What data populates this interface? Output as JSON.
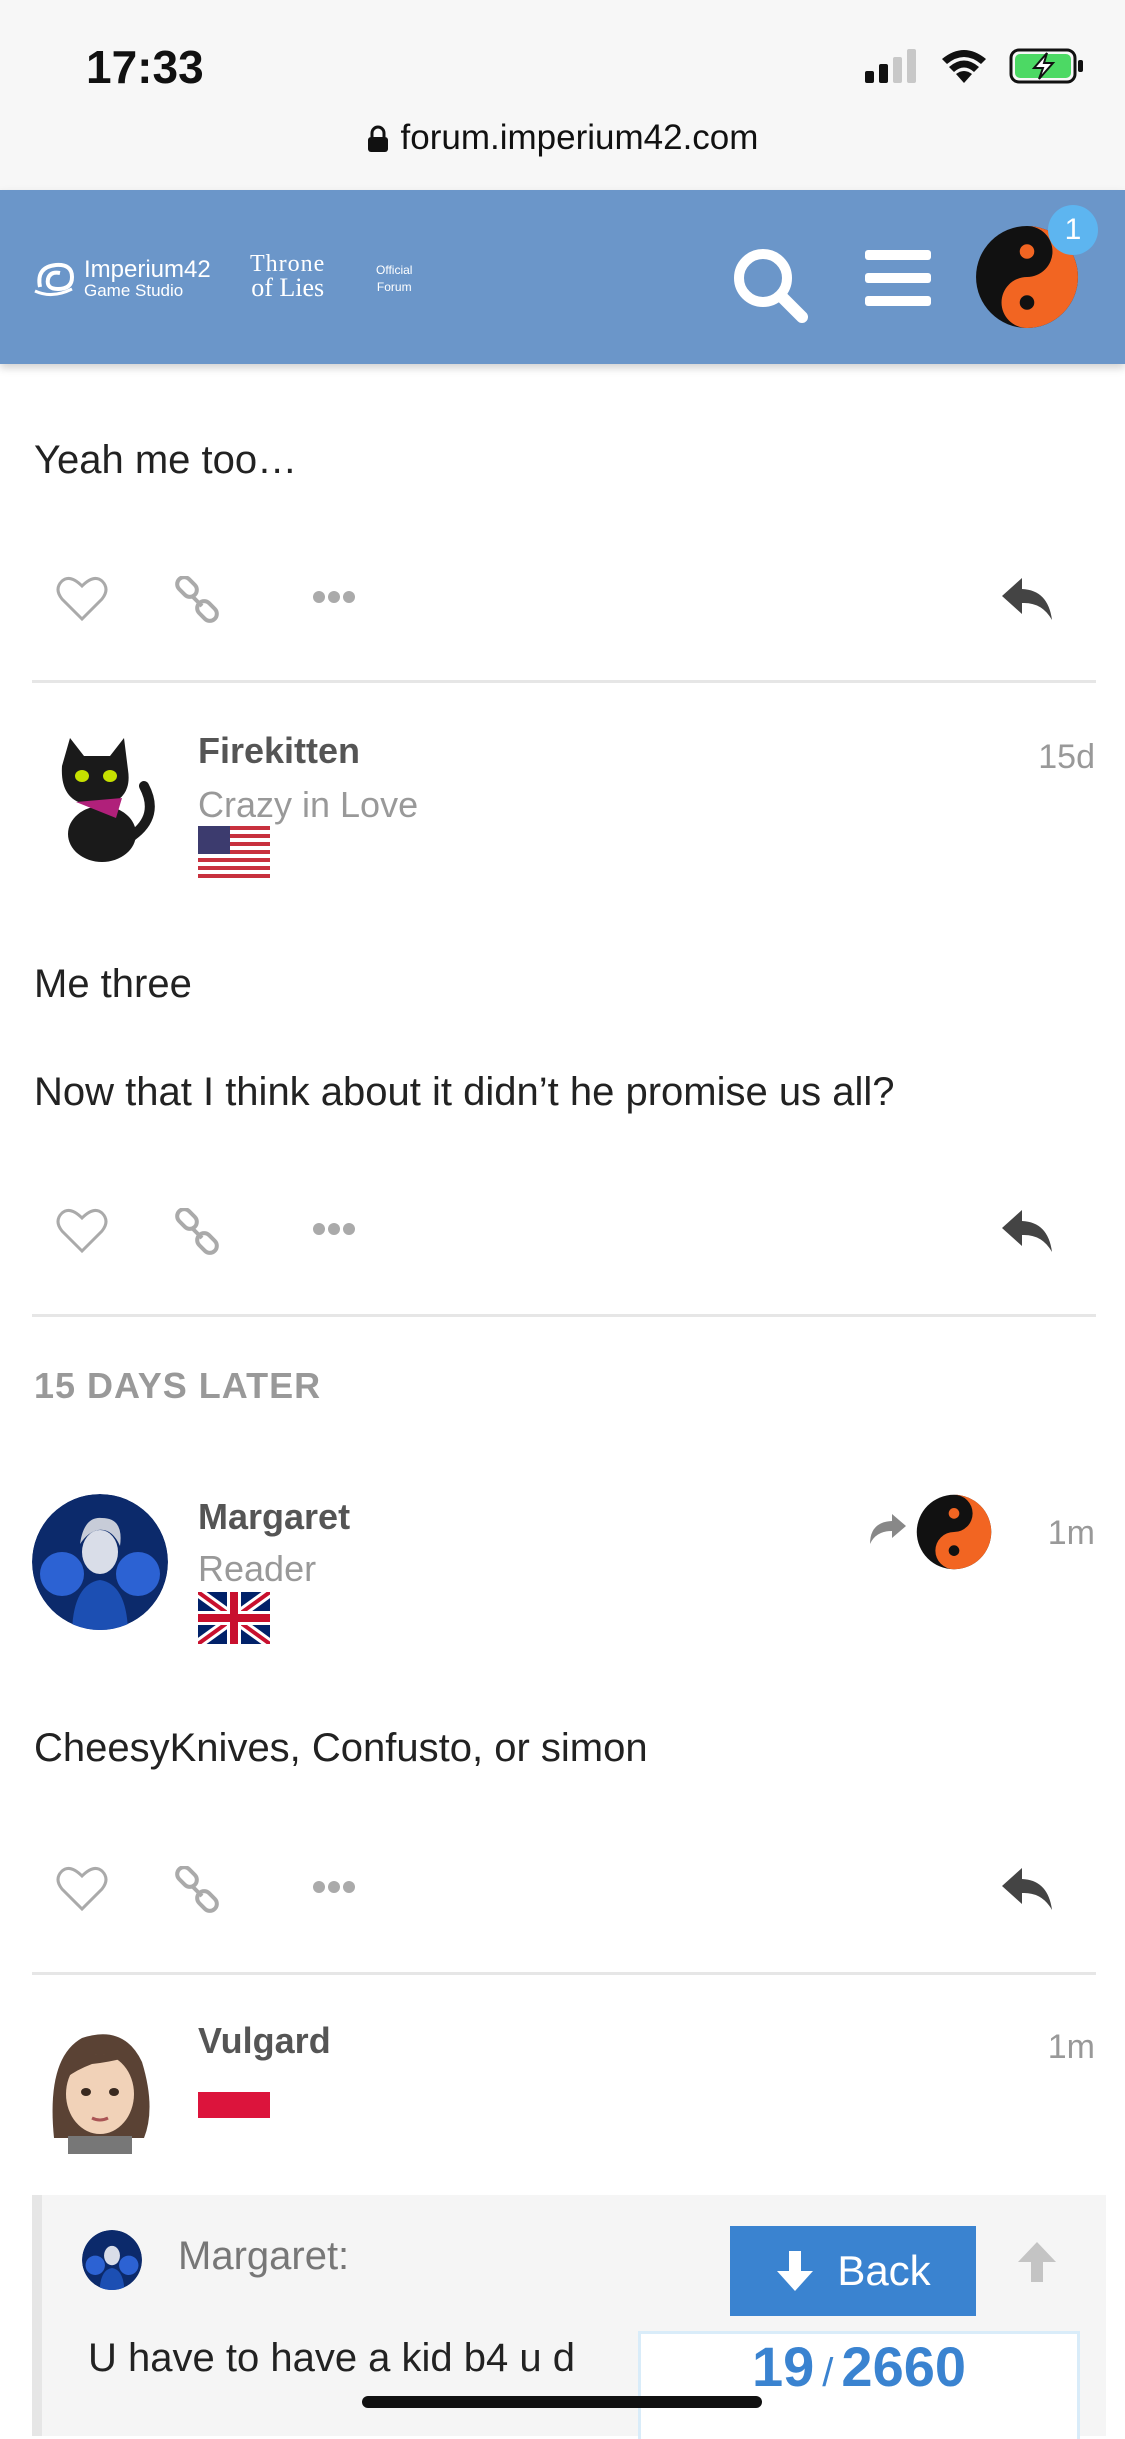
{
  "status_bar": {
    "time": "17:33",
    "url": "forum.imperium42.com"
  },
  "header": {
    "logo_primary": "Imperium42",
    "logo_primary_sub": "Game Studio",
    "logo_game_line1": "Throne",
    "logo_game_line2": "of Lies",
    "logo_official_line1": "Official",
    "logo_official_line2": "Forum",
    "notification_count": "1"
  },
  "posts": [
    {
      "text": [
        "Yeah me too…"
      ]
    },
    {
      "username": "Firekitten",
      "user_title": "Crazy in Love",
      "flag": "us-flag",
      "age": "15d",
      "text": [
        "Me three",
        "Now that I think about it didn’t he promise us all?"
      ]
    },
    {
      "username": "Margaret",
      "user_title": "Reader",
      "flag": "uk-flag",
      "age": "1m",
      "text": [
        "CheesyKnives, Confusto, or simon"
      ]
    },
    {
      "username": "Vulgard",
      "flag": "poland-flag",
      "age": "1m",
      "quote": {
        "author": "Margaret:",
        "text": "U have to have a kid b4 u d"
      }
    }
  ],
  "time_gap": "15 DAYS LATER",
  "navigation": {
    "back_label": "Back",
    "current_post": "19",
    "separator": "/",
    "total_posts": "2660"
  },
  "colors": {
    "header_bg": "#6b96c9",
    "accent": "#3a83d0",
    "badge": "#5db5f0",
    "yin_yang_orange": "#f26522"
  }
}
